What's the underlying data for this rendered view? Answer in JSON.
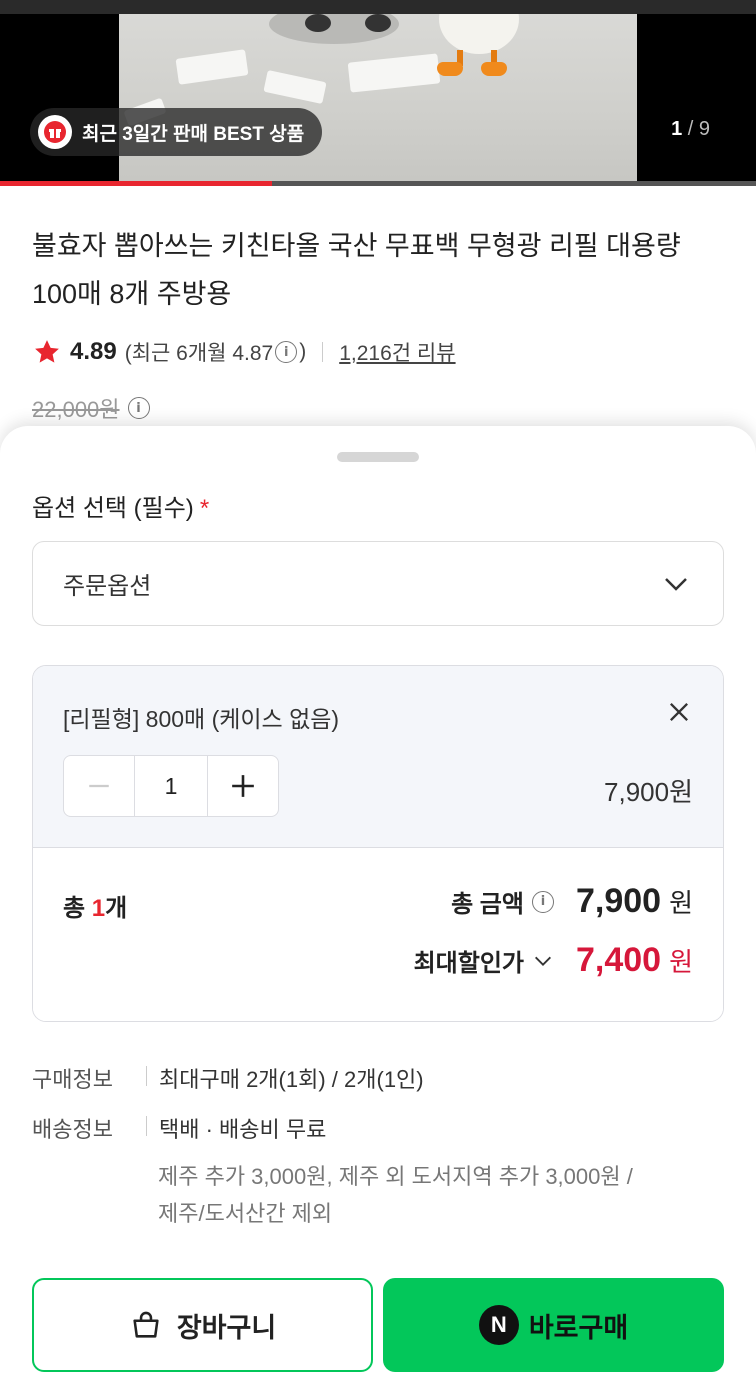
{
  "hero": {
    "badge_text": "최근 3일간 판매 BEST 상품",
    "page_current": "1",
    "page_separator": "/",
    "page_total": "9",
    "progress_fraction": 0.36
  },
  "product": {
    "title": "불효자 뽑아쓰는 키친타올 국산 무표백 무형광 리필 대용량 100매 8개 주방용",
    "rating": "4.89",
    "recent_rating": "(최근 6개월 4.87",
    "recent_rating_close": ")",
    "review_count": "1,216건 리뷰",
    "original_price": "22,000원"
  },
  "sheet": {
    "option_label": "옵션 선택 (필수)",
    "required_mark": "*",
    "select_placeholder": "주문옵션",
    "cart_item": {
      "name": "[리필형] 800매 (케이스 없음)",
      "quantity": "1",
      "price": "7,900원"
    },
    "totals": {
      "count_prefix": "총 ",
      "count_num": "1",
      "count_suffix": "개",
      "amount_label": "총 금액",
      "amount": "7,900",
      "amount_unit": "원",
      "discount_label": "최대할인가",
      "discount_amount": "7,400",
      "discount_unit": "원"
    },
    "purchase_info_label": "구매정보",
    "purchase_info_value": "최대구매 2개(1회) / 2개(1인)",
    "shipping_info_label": "배송정보",
    "shipping_info_value": "택배 · 배송비 무료",
    "shipping_note_line1": "제주 추가 3,000원, 제주 외 도서지역 추가 3,000원 /",
    "shipping_note_line2": "제주/도서산간 제외",
    "cart_button": "장바구니",
    "buy_button": "바로구매",
    "n_logo": "N"
  },
  "colors": {
    "accent_red": "#e8262f",
    "discount_red": "#d6173a",
    "naver_green": "#03c75a"
  }
}
